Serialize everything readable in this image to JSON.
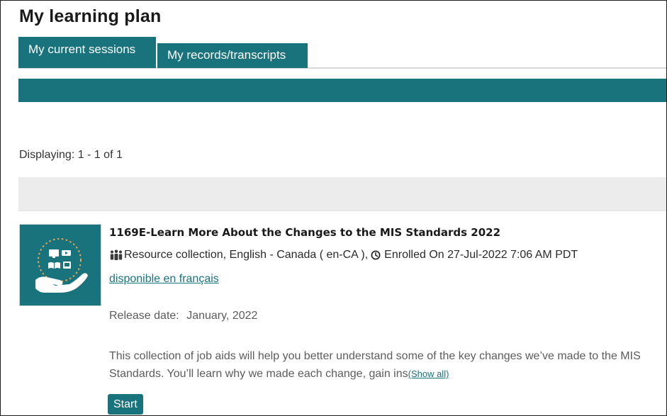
{
  "page": {
    "title": "My learning plan"
  },
  "tabs": [
    {
      "label": "My current sessions",
      "active": true
    },
    {
      "label": "My records/transcripts",
      "active": false
    }
  ],
  "pagination": {
    "displaying": "Displaying: 1 - 1 of 1"
  },
  "session": {
    "title": "1169E-Learn More About the Changes to the MIS Standards 2022",
    "type_language": "Resource collection, English - Canada ( en-CA ),",
    "enrolled": "Enrolled On 27-Jul-2022 7:06 AM PDT",
    "french_link": "disponible en français",
    "release_label": "Release date:",
    "release_value": "January, 2022",
    "description": "This collection of job aids will help you better understand some of the key changes we’ve made to the MIS Standards. You’ll learn why we made each change, gain ins",
    "show_all": "(Show all)",
    "start_label": "Start",
    "thumbnail_icon": "devices-in-hand-icon"
  },
  "colors": {
    "accent": "#19737d",
    "band_grey": "#ececec",
    "muted_text": "#5c5c5c"
  }
}
